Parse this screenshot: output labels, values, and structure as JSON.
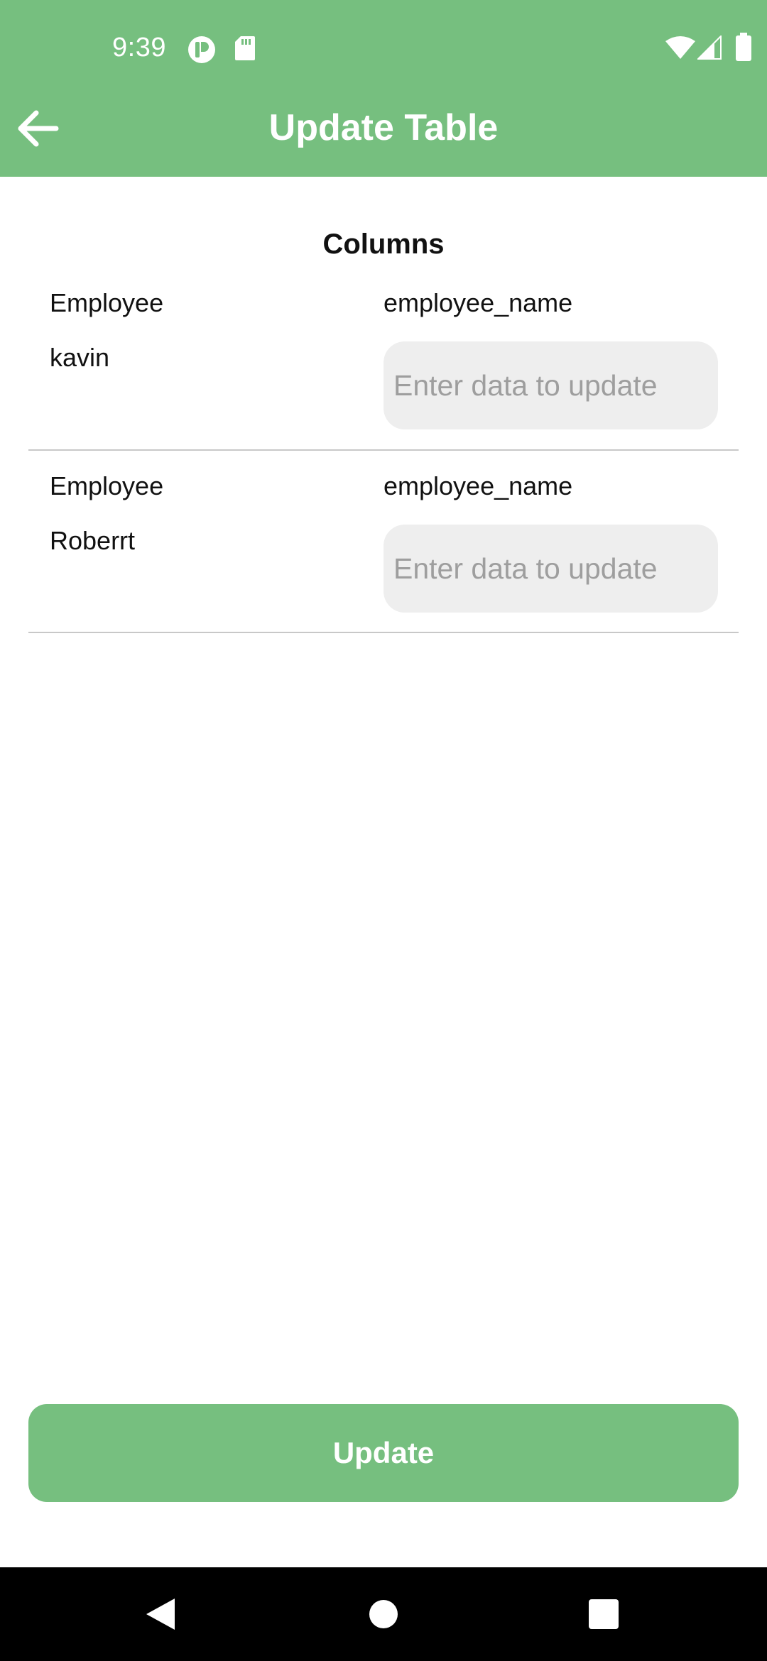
{
  "status_bar": {
    "time": "9:39",
    "left_icons": [
      "app-notification-icon",
      "sd-card-icon"
    ],
    "right_icons": [
      "wifi-icon",
      "cell-signal-icon",
      "battery-icon"
    ]
  },
  "app_bar": {
    "title": "Update Table",
    "back_icon": "arrow-left-icon",
    "color": "#76bf7f"
  },
  "content": {
    "section_title": "Columns",
    "rows": [
      {
        "table": "Employee",
        "column": "employee_name",
        "current_value": "kavin",
        "input_placeholder": "Enter data to update",
        "input_value": ""
      },
      {
        "table": "Employee",
        "column": "employee_name",
        "current_value": "Roberrt",
        "input_placeholder": "Enter data to update",
        "input_value": ""
      }
    ]
  },
  "actions": {
    "update_label": "Update"
  },
  "nav_bar": {
    "buttons": [
      "back-icon",
      "home-icon",
      "recents-icon"
    ]
  }
}
